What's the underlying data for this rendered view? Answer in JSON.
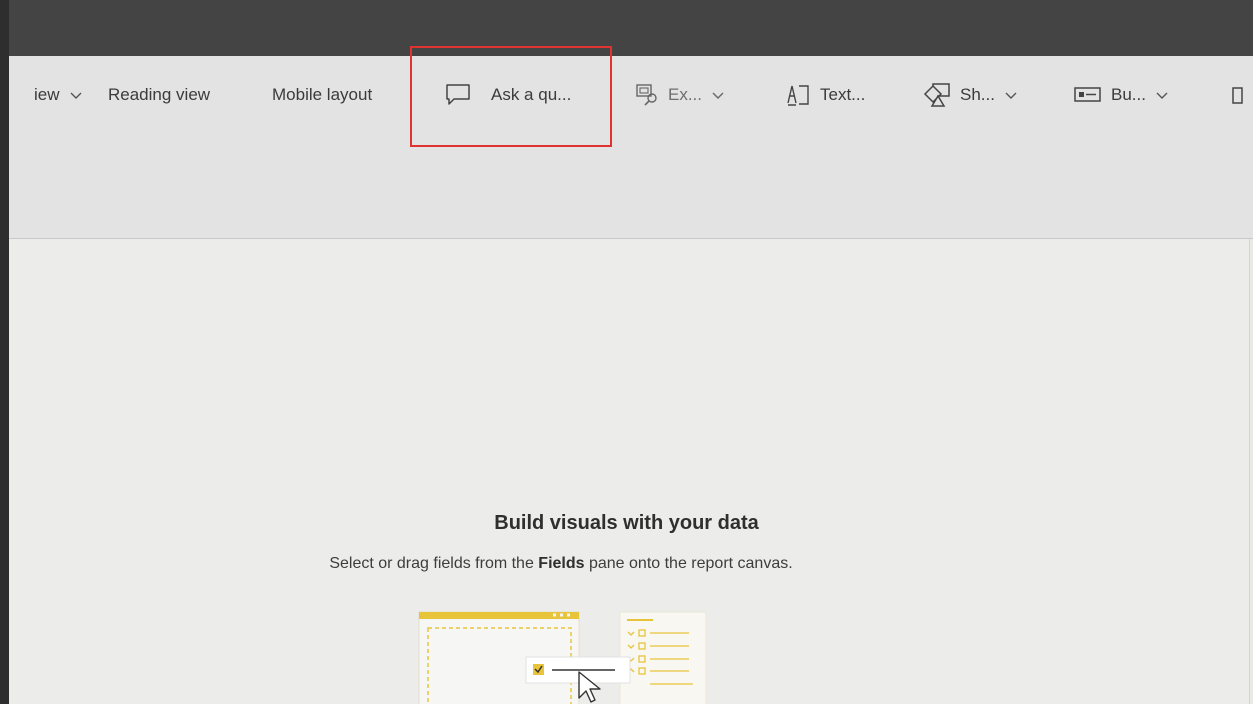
{
  "ribbon": {
    "items": [
      {
        "label": "iew",
        "has_dropdown": true
      },
      {
        "label": "Reading view",
        "has_dropdown": false
      },
      {
        "label": "Mobile layout",
        "has_dropdown": false
      },
      {
        "label": "Ask a qu...",
        "icon": "comment-icon",
        "has_dropdown": false,
        "highlighted": true
      },
      {
        "label": "Ex...",
        "icon": "explore-icon",
        "has_dropdown": true
      },
      {
        "label": "Text...",
        "icon": "textbox-icon",
        "has_dropdown": false
      },
      {
        "label": "Sh...",
        "icon": "shapes-icon",
        "has_dropdown": true
      },
      {
        "label": "Bu...",
        "icon": "button-icon",
        "has_dropdown": true
      }
    ]
  },
  "canvas": {
    "empty_title": "Build visuals with your data",
    "empty_sub_before": "Select or drag fields from the ",
    "empty_sub_bold": "Fields",
    "empty_sub_after": " pane onto the report canvas."
  },
  "colors": {
    "highlight": "#e0322f",
    "accent": "#e8c43a"
  }
}
